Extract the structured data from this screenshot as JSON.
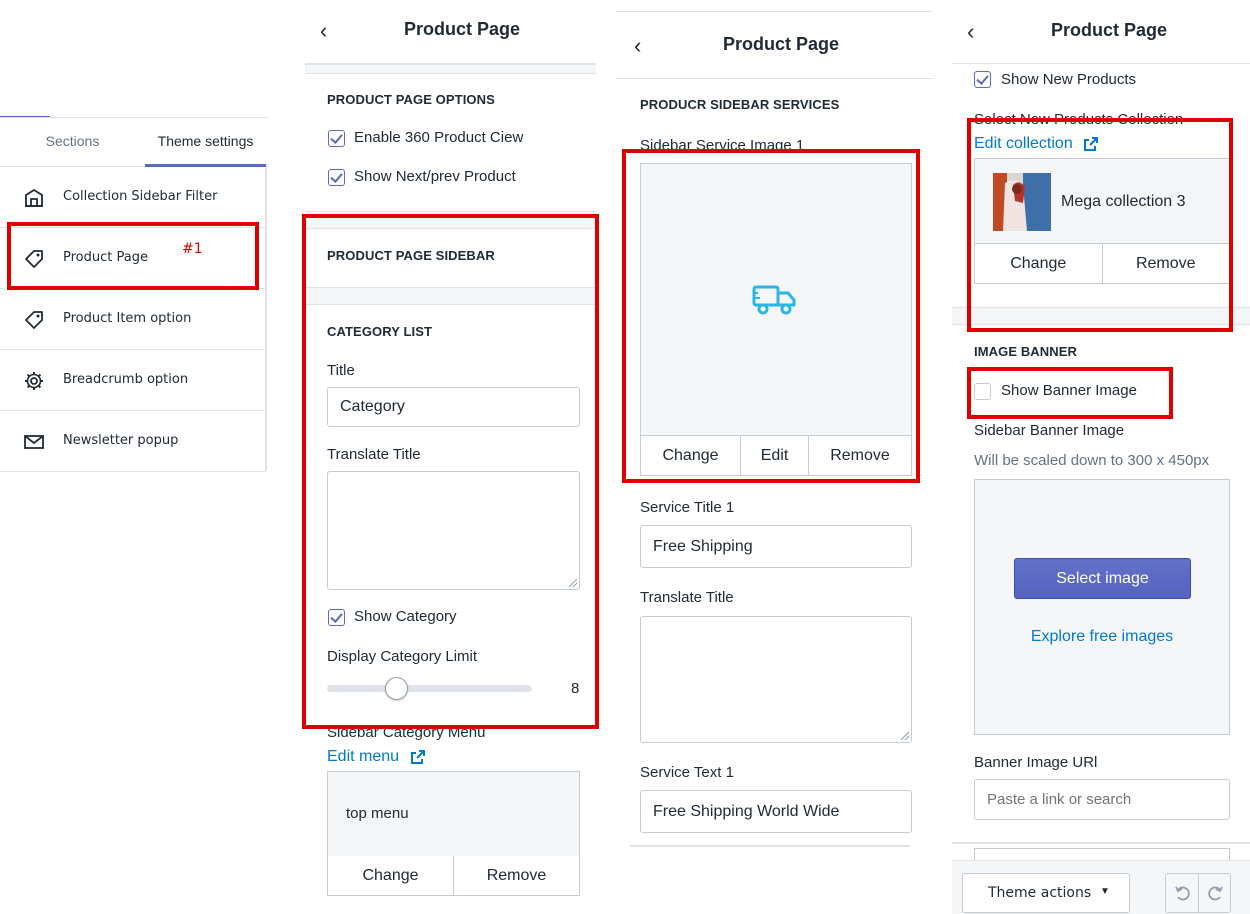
{
  "panel1": {
    "tabs": [
      "Sections",
      "Theme settings"
    ],
    "items": [
      {
        "label": "Collection Sidebar Filter",
        "icon": "store-icon"
      },
      {
        "label": "Product Page",
        "icon": "tag-icon"
      },
      {
        "label": "Product Item option",
        "icon": "tag-icon"
      },
      {
        "label": "Breadcrumb option",
        "icon": "gear-icon"
      },
      {
        "label": "Newsletter popup",
        "icon": "envelope-icon"
      }
    ],
    "annotation": "#1"
  },
  "panel2": {
    "title": "Product Page",
    "options_heading": "PRODUCT PAGE OPTIONS",
    "enable_360": "Enable 360 Product Ciew",
    "show_next_prev": "Show Next/prev Product",
    "sidebar_heading": "PRODUCT PAGE SIDEBAR",
    "category_heading": "CATEGORY LIST",
    "title_label": "Title",
    "title_value": "Category",
    "translate_label": "Translate Title",
    "show_category": "Show Category",
    "limit_label": "Display Category Limit",
    "limit_value": "8",
    "limit_fraction": 0.32,
    "menu_label": "Sidebar Category Menu",
    "edit_menu": "Edit menu",
    "menu_value": "top menu",
    "change": "Change",
    "remove": "Remove"
  },
  "panel3": {
    "title": "Product Page",
    "heading": "PRODUCR SIDEBAR SERVICES",
    "image_label": "Sidebar Service Image 1",
    "change": "Change",
    "edit": "Edit",
    "remove": "Remove",
    "service_title_label": "Service Title 1",
    "service_title_value": "Free Shipping",
    "translate_label": "Translate Title",
    "service_text_label": "Service Text 1",
    "service_text_value": "Free Shipping World Wide",
    "accent_color": "#2ab7e3"
  },
  "panel4": {
    "title": "Product Page",
    "show_new_products": "Show New Products",
    "select_collection_label": "Select New Products Collection",
    "edit_collection": "Edit collection",
    "collection_name": "Mega collection 3",
    "change": "Change",
    "remove": "Remove",
    "banner_heading": "IMAGE BANNER",
    "show_banner": "Show Banner Image",
    "banner_image_label": "Sidebar Banner Image",
    "banner_hint": "Will be scaled down to 300 x 450px",
    "select_image": "Select image",
    "explore": "Explore free images",
    "banner_url_label": "Banner Image URl",
    "banner_url_placeholder": "Paste a link or search",
    "theme_actions": "Theme actions"
  }
}
